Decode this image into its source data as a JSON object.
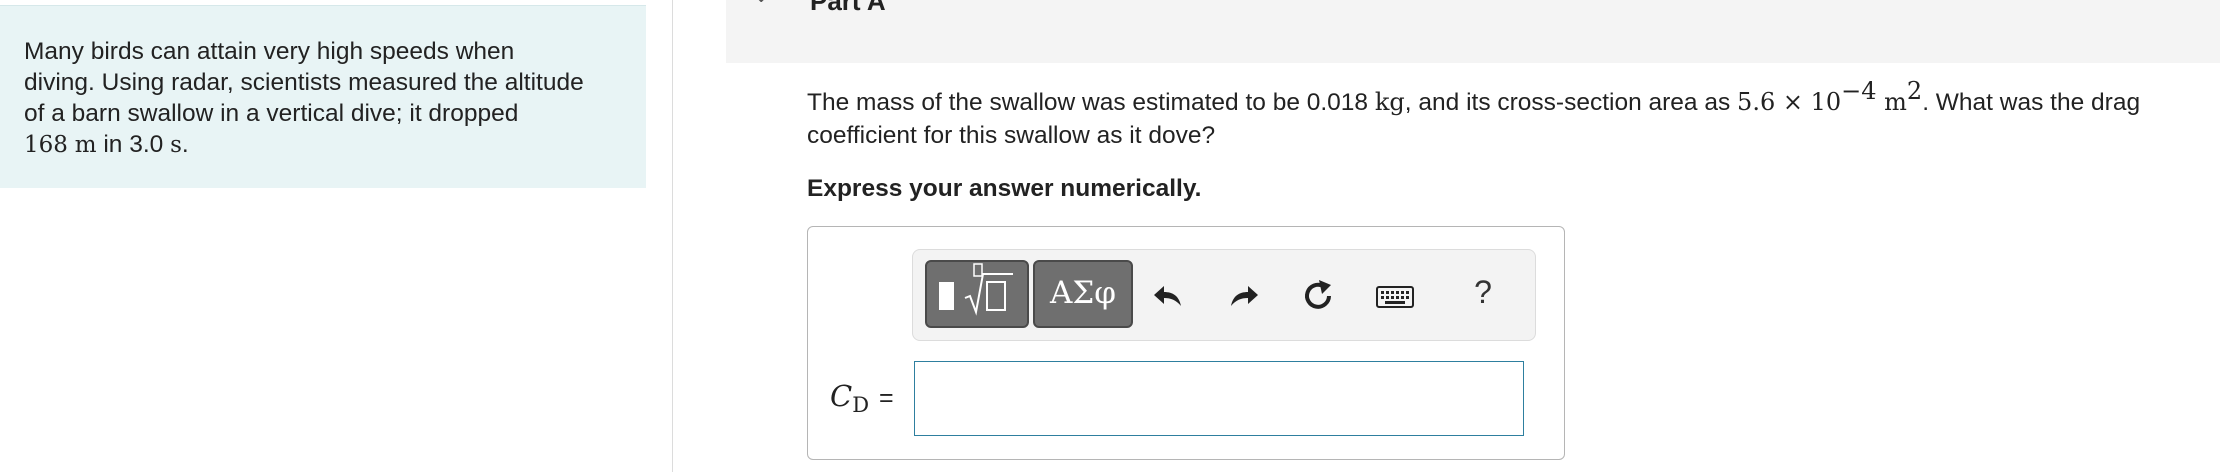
{
  "intro": {
    "line1": "Many birds can attain very high speeds when",
    "line2": "diving. Using radar, scientists measured the altitude",
    "line3": "of a barn swallow in a vertical dive; it dropped",
    "line4_num": "168",
    "line4_unit1": "m",
    "line4_mid": " in 3.0 ",
    "line4_unit2": "s",
    "line4_end": "."
  },
  "part": {
    "title": "Part A",
    "chevron": "⌄"
  },
  "question": {
    "t1": "The mass of the swallow was estimated to be 0.018 ",
    "u1": "kg",
    "t2": ", and its cross-section area as ",
    "m1": "5.6 × 10",
    "exp1": "−4",
    "u2": " m",
    "exp2": "2",
    "t3": ". What was the drag",
    "line2": "coefficient for this swallow as it dove?"
  },
  "instruction": "Express your answer numerically.",
  "toolbar": {
    "symbols_label": "ΑΣφ",
    "help_label": "?",
    "icons": [
      "templates-icon",
      "symbols",
      "undo-icon",
      "redo-icon",
      "reset-icon",
      "keyboard-icon",
      "help"
    ]
  },
  "answer": {
    "var": "C",
    "sub": "D",
    "equals": "=",
    "value": ""
  },
  "colors": {
    "intro_bg": "#e8f4f5",
    "header_bg": "#f4f4f4",
    "input_border": "#2e7f9f",
    "toolbar_button": "#6f6f6f"
  }
}
